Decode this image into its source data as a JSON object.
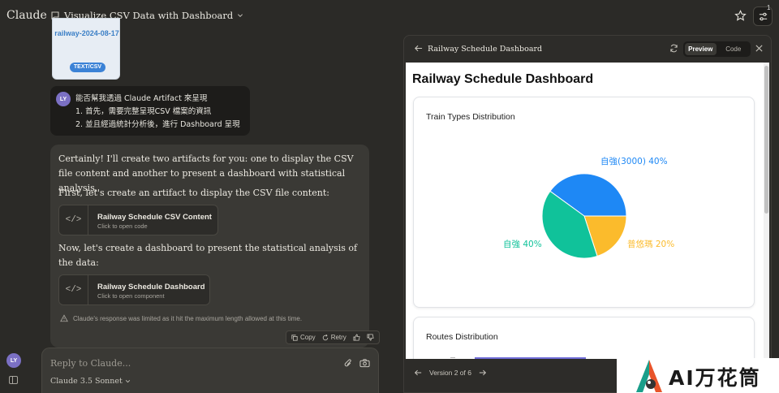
{
  "app": {
    "brand": "Claude",
    "chat_title": "Visualize CSV Data with Dashboard",
    "settings_badge": "1"
  },
  "file": {
    "name": "railway-2024-08-17",
    "type": "TEXT/CSV"
  },
  "user": {
    "initials": "LY",
    "message_lines": [
      "能否幫我透過 Claude Artifact 來呈現",
      "1. 首先，需要完整呈現CSV 檔案的資訊",
      "2. 並且經過統計分析後，進行 Dashboard 呈現"
    ]
  },
  "assistant": {
    "para1": "Certainly! I'll create two artifacts for you: one to display the CSV file content and another to present a dashboard with statistical analysis.",
    "para2": "First, let's create an artifact to display the CSV file content:",
    "artifact1": {
      "title": "Railway Schedule CSV Content",
      "subtitle": "Click to open code"
    },
    "para3": "Now, let's create a dashboard to present the statistical analysis of the data:",
    "artifact2": {
      "title": "Railway Schedule Dashboard",
      "subtitle": "Click to open component"
    },
    "warning": "Claude's response was limited as it hit the maximum length allowed at this time.",
    "actions": {
      "copy": "Copy",
      "retry": "Retry"
    }
  },
  "composer": {
    "placeholder": "Reply to Claude...",
    "model": "Claude 3.5 Sonnet"
  },
  "panel": {
    "title": "Railway Schedule Dashboard",
    "tabs": {
      "preview": "Preview",
      "code": "Code"
    },
    "version": "Version 2 of 6"
  },
  "dashboard": {
    "title": "Railway Schedule Dashboard",
    "card1_title": "Train Types Distribution",
    "card2_title": "Routes Distribution"
  },
  "chart_data": {
    "type": "pie",
    "title": "Train Types Distribution",
    "slices": [
      {
        "label": "自強(3000) 40%",
        "value": 40,
        "color": "#1e88f5"
      },
      {
        "label": "普悠瑪 20%",
        "value": 20,
        "color": "#fbbb2c"
      },
      {
        "label": "自強 40%",
        "value": 40,
        "color": "#10c29a"
      }
    ]
  },
  "watermark": {
    "text": "AI万花筒"
  }
}
